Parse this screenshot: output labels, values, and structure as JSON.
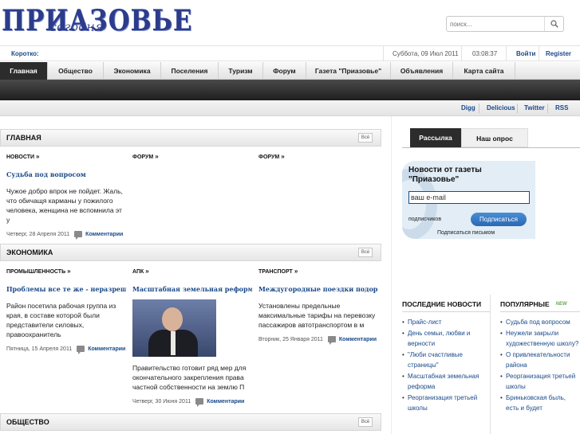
{
  "header": {
    "logo_text": "ПРИАЗОВЬЕ",
    "logo_sub": "сегодня",
    "search_placeholder": "поиск..."
  },
  "infobar": {
    "brief_label": "Коротко:",
    "date": "Суббота, 09 Июл 2011",
    "time": "03:08:37",
    "login": "Войти",
    "register": "Register"
  },
  "nav": {
    "items": [
      "Главная",
      "Общество",
      "Экономика",
      "Поселения",
      "Туризм",
      "Форум",
      "Газета \"Приазовье\"",
      "Объявления",
      "Карта сайта"
    ]
  },
  "social": {
    "items": [
      "Digg",
      "Delicious",
      "Twitter",
      "RSS"
    ]
  },
  "sections": {
    "main": {
      "title": "ГЛАВНАЯ",
      "all_label": "Всё",
      "cols": [
        {
          "category": "НОВОСТИ",
          "headline": "Судьба под вопросом",
          "text": "Чужое добро впрок не пойдет. Жаль, что обичащя карманы у пожилого человека, женщина не вспомнила эт у",
          "date": "Четверг, 28 Апреля 2011",
          "comments": "Комментарии"
        },
        {
          "category": "ФОРУМ"
        },
        {
          "category": "ФОРУМ"
        }
      ]
    },
    "economy": {
      "title": "ЭКОНОМИКА",
      "all_label": "Всё",
      "cols": [
        {
          "category": "ПРОМЫШЛЕННОСТЬ",
          "headline": "Проблемы все те же - неразрешимые",
          "text": "Район посетила рабочая группа из края, в составе которой были представители силовых, правоохранитель",
          "date": "Пятница, 15 Апреля 2011",
          "comments": "Комментарии"
        },
        {
          "category": "АПК",
          "headline": "Масштабная земельная реформа",
          "text": "Правительство готовит ряд мер для окончательного закрепления права частной собственности на землю П",
          "date": "Четверг, 30 Июня 2011",
          "comments": "Комментарии"
        },
        {
          "category": "ТРАНСПОРТ",
          "headline": "Междугородные поездки подорожали",
          "text": "Установлены предельные максимальные тарифы на перевозку пассажиров автотранспортом в м",
          "date": "Вторник, 25 Января 2011",
          "comments": "Комментарии"
        }
      ]
    },
    "society": {
      "title": "ОБЩЕСТВО",
      "all_label": "Всё"
    }
  },
  "sidebar": {
    "tabs": [
      "Рассылка",
      "Наш опрос"
    ],
    "newsletter": {
      "title": "Новости от газеты \"Приазовье\"",
      "email_value": "ваш e-mail",
      "subscribers_label": "подписчиков",
      "subscribe_button": "Подписаться",
      "letter_link": "Подписаться письмом"
    },
    "last_news": {
      "title": "ПОСЛЕДНИЕ НОВОСТИ",
      "items": [
        "Прайс-лист",
        "День семьи, любви и верности",
        "\"Люби счастливые страницы\"",
        "Масштабная земельная реформа",
        "Реорганизация третьей школы"
      ]
    },
    "popular": {
      "title": "ПОПУЛЯРНЫЕ",
      "badge": "NEW",
      "items": [
        "Судьба под вопросом",
        "Неужели закрыли художественную школу?",
        "О привлекательности района",
        "Реорганизация третьей школы",
        "Бриньковская быль, есть и будет"
      ]
    }
  }
}
